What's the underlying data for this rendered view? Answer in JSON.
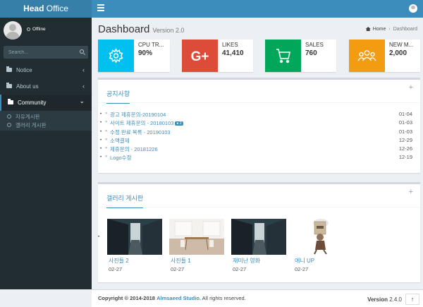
{
  "header": {
    "logo_bold": "Head",
    "logo_rest": " Office"
  },
  "sidebar": {
    "status": "Offline",
    "search_placeholder": "Search...",
    "items": [
      {
        "label": "Notice",
        "chevron": "‹"
      },
      {
        "label": "About us",
        "chevron": "‹"
      },
      {
        "label": "Community",
        "chevron": "⌄"
      }
    ],
    "subitems": [
      "자유게시판",
      "갤러리 게시판"
    ]
  },
  "content": {
    "title": "Dashboard",
    "subtitle": "Version 2.0",
    "breadcrumb_home": "Home",
    "breadcrumb_current": "Dashboard"
  },
  "info_boxes": [
    {
      "label": "CPU TR...",
      "value": "90%",
      "color": "#00c0ef",
      "icon": "gear-icon"
    },
    {
      "label": "LIKES",
      "value": "41,410",
      "color": "#dd4b39",
      "icon": "google-plus-icon"
    },
    {
      "label": "SALES",
      "value": "760",
      "color": "#00a65a",
      "icon": "shopping-cart-icon"
    },
    {
      "label": "NEW M...",
      "value": "2,000",
      "color": "#f39c12",
      "icon": "users-icon"
    }
  ],
  "notice_box": {
    "tab": "공지사항",
    "items": [
      {
        "title": "광고 제휴문의-20190104",
        "badge": "",
        "date": "01-04"
      },
      {
        "title": "사이트 제휴문의 - 20180103",
        "badge": "2",
        "date": "01-03"
      },
      {
        "title": "수정 완료 목록 - 20190103",
        "badge": "",
        "date": "01-03"
      },
      {
        "title": "소액결제",
        "badge": "",
        "date": "12-29"
      },
      {
        "title": "제휴문의 - 20181226",
        "badge": "",
        "date": "12-26"
      },
      {
        "title": "Logo수정",
        "badge": "",
        "date": "12-19"
      }
    ]
  },
  "gallery_box": {
    "tab": "갤러리 게시판",
    "items": [
      {
        "title": "사진들 2",
        "date": "02-27"
      },
      {
        "title": "사진들 1",
        "date": "02-27"
      },
      {
        "title": "재미난 영화",
        "date": "02-27"
      },
      {
        "title": "애니 UP",
        "date": "02-27"
      }
    ]
  },
  "footer": {
    "copyright_prefix": "Copyright © 2014-2018",
    "studio": "Almsaeed Studio.",
    "suffix": " All rights reserved.",
    "version_label": "Version",
    "version_value": " 2.4.0",
    "up_arrow": "↑"
  }
}
